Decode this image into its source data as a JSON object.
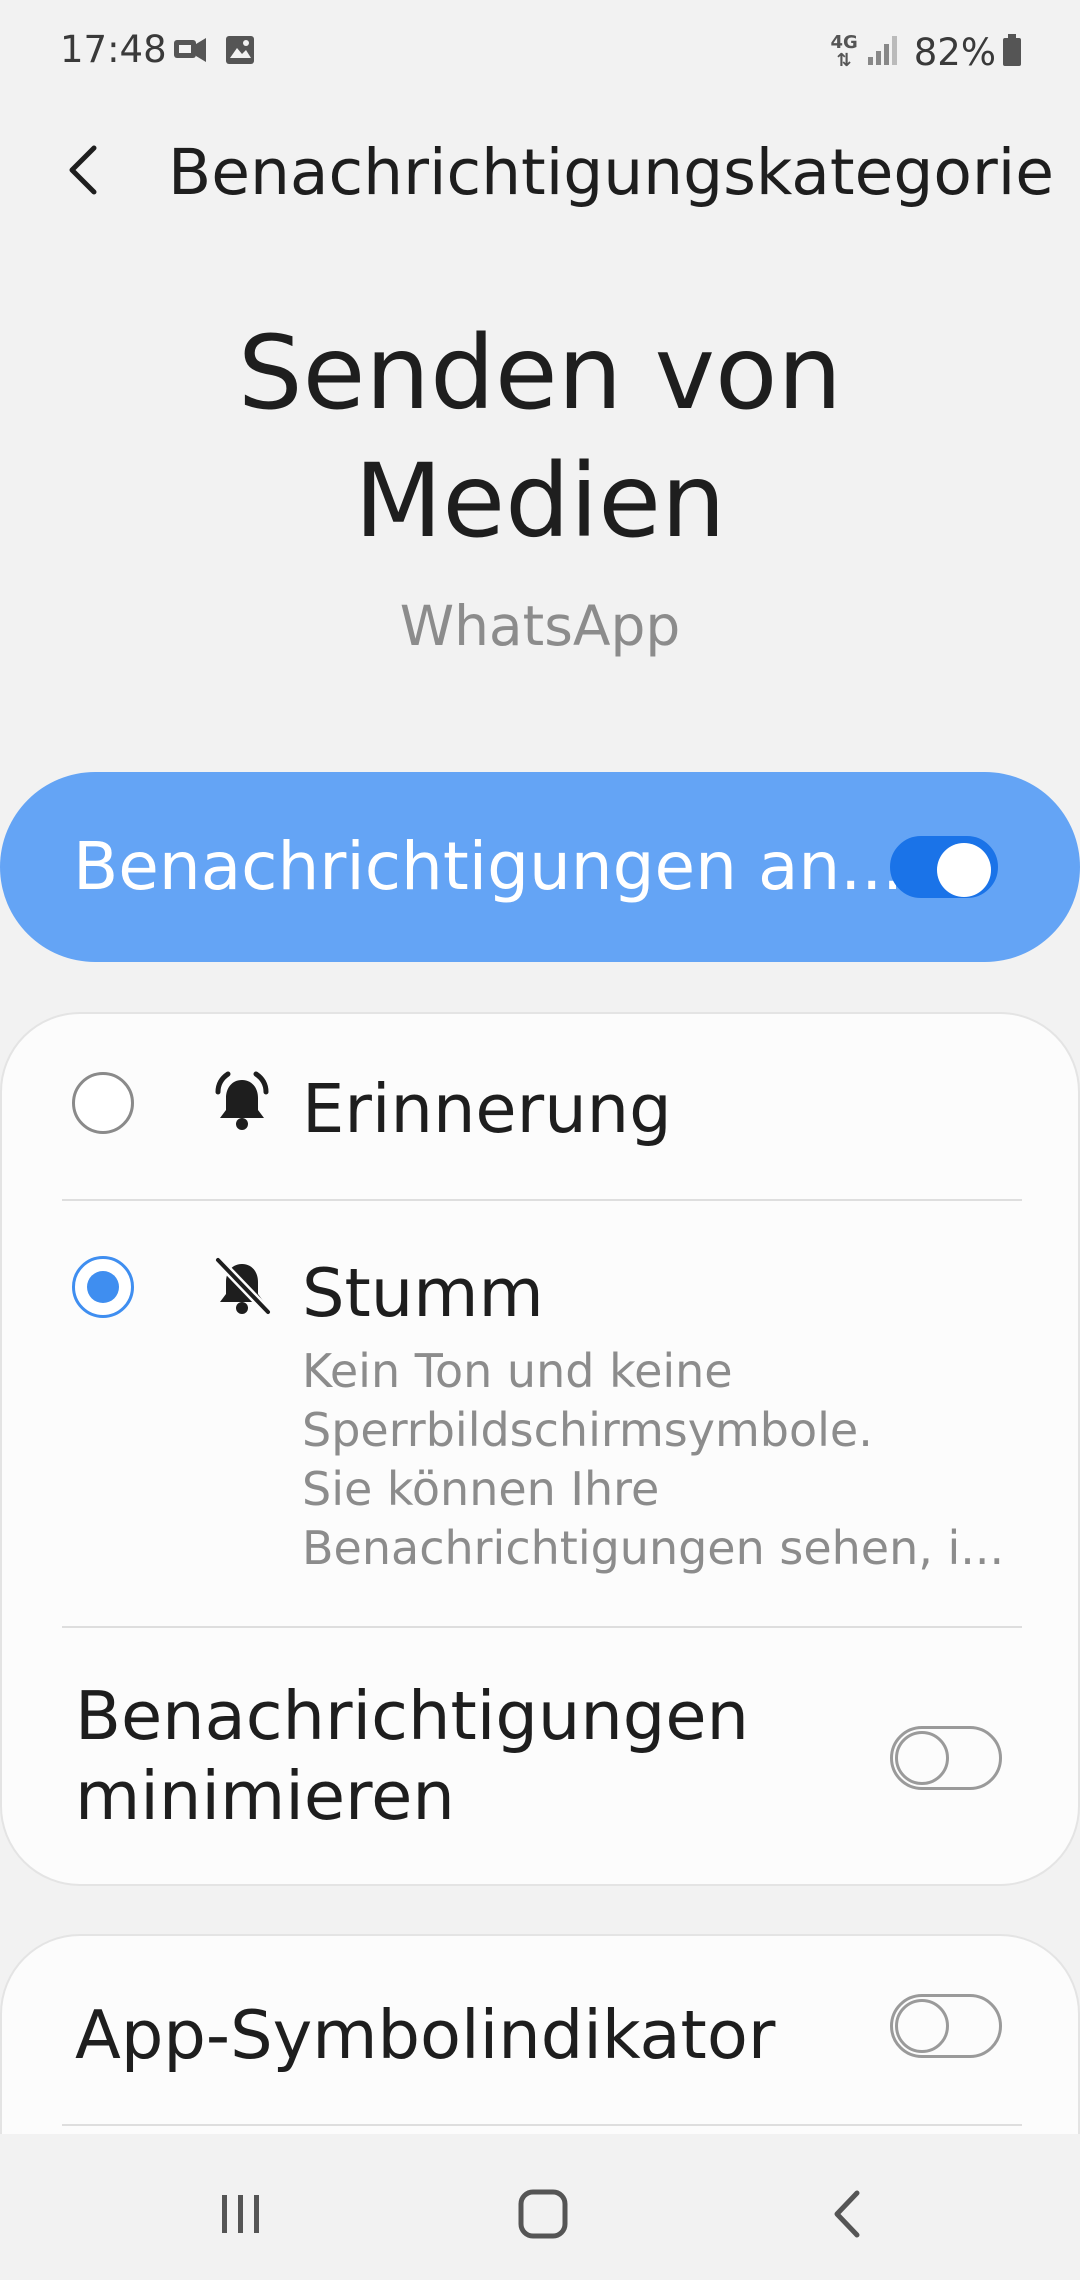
{
  "status_bar": {
    "time": "17:48",
    "network": "4G",
    "battery": "82%",
    "icons": [
      "sim-card-icon",
      "image-icon",
      "4g-icon",
      "signal-icon",
      "battery-icon"
    ]
  },
  "header": {
    "back_icon": "chevron-left-icon",
    "title": "Benachrichtigungskategorie"
  },
  "page": {
    "title_line1": "Senden von",
    "title_line2": "Medien",
    "app_name": "WhatsApp"
  },
  "master_toggle": {
    "label": "Benachrichtigungen an...",
    "state": "on",
    "color": "#64a4f5"
  },
  "options": [
    {
      "label": "Erinnerung",
      "icon": "bell-ring-icon",
      "selected": false
    },
    {
      "label": "Stumm",
      "icon": "bell-off-icon",
      "selected": true,
      "description": [
        "Kein Ton und keine",
        "Sperrbildschirmsymbole.",
        "Sie können Ihre",
        "Benachrichtigungen sehen, i..."
      ]
    }
  ],
  "minimize": {
    "label_line1": "Benachrichtigungen",
    "label_line2": "minimieren",
    "state": "off"
  },
  "app_badge": {
    "label": "App-Symbolindikator",
    "state": "off"
  },
  "nav": {
    "icons": [
      "recent-apps-icon",
      "home-icon",
      "back-icon"
    ]
  },
  "colors": {
    "accent": "#3f8ef0",
    "switch_on": "#1a73e8",
    "background": "#f2f2f2"
  }
}
